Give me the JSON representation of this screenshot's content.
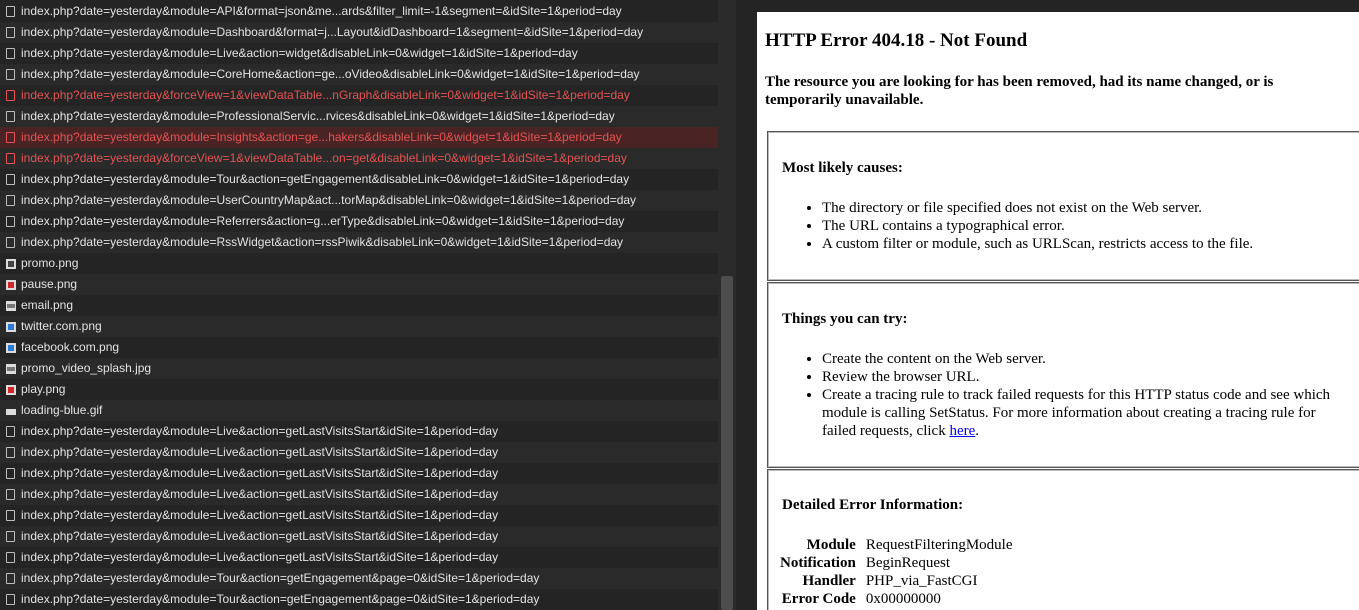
{
  "requests": [
    {
      "label": "index.php?date=yesterday&module=API&format=json&me...ards&filter_limit=-1&segment=&idSite=1&period=day",
      "icon": "doc-icon",
      "kind": "doc",
      "status": "ok"
    },
    {
      "label": "index.php?date=yesterday&module=Dashboard&format=j...Layout&idDashboard=1&segment=&idSite=1&period=day",
      "icon": "doc-icon",
      "kind": "doc",
      "status": "ok"
    },
    {
      "label": "index.php?date=yesterday&module=Live&action=widget&disableLink=0&widget=1&idSite=1&period=day",
      "icon": "doc-icon",
      "kind": "doc",
      "status": "ok"
    },
    {
      "label": "index.php?date=yesterday&module=CoreHome&action=ge...oVideo&disableLink=0&widget=1&idSite=1&period=day",
      "icon": "doc-icon",
      "kind": "doc",
      "status": "ok"
    },
    {
      "label": "index.php?date=yesterday&forceView=1&viewDataTable...nGraph&disableLink=0&widget=1&idSite=1&period=day",
      "icon": "doc-icon",
      "kind": "doc",
      "status": "error"
    },
    {
      "label": "index.php?date=yesterday&module=ProfessionalServic...rvices&disableLink=0&widget=1&idSite=1&period=day",
      "icon": "doc-icon",
      "kind": "doc",
      "status": "ok"
    },
    {
      "label": "index.php?date=yesterday&module=Insights&action=ge...hakers&disableLink=0&widget=1&idSite=1&period=day",
      "icon": "doc-icon",
      "kind": "doc",
      "status": "error-selected"
    },
    {
      "label": "index.php?date=yesterday&forceView=1&viewDataTable...on=get&disableLink=0&widget=1&idSite=1&period=day",
      "icon": "doc-icon",
      "kind": "doc",
      "status": "error"
    },
    {
      "label": "index.php?date=yesterday&module=Tour&action=getEngagement&disableLink=0&widget=1&idSite=1&period=day",
      "icon": "doc-icon",
      "kind": "doc",
      "status": "ok"
    },
    {
      "label": "index.php?date=yesterday&module=UserCountryMap&act...torMap&disableLink=0&widget=1&idSite=1&period=day",
      "icon": "doc-icon",
      "kind": "doc",
      "status": "ok"
    },
    {
      "label": "index.php?date=yesterday&module=Referrers&action=g...erType&disableLink=0&widget=1&idSite=1&period=day",
      "icon": "doc-icon",
      "kind": "doc",
      "status": "ok"
    },
    {
      "label": "index.php?date=yesterday&module=RssWidget&action=rssPiwik&disableLink=0&widget=1&idSite=1&period=day",
      "icon": "doc-icon",
      "kind": "doc",
      "status": "ok"
    },
    {
      "label": "promo.png",
      "icon": "image-icon",
      "kind": "img dark",
      "status": "ok"
    },
    {
      "label": "pause.png",
      "icon": "image-icon",
      "kind": "img red",
      "status": "ok"
    },
    {
      "label": "email.png",
      "icon": "image-icon",
      "kind": "img gray",
      "status": "ok"
    },
    {
      "label": "twitter.com.png",
      "icon": "image-icon",
      "kind": "img blue",
      "status": "ok"
    },
    {
      "label": "facebook.com.png",
      "icon": "image-icon",
      "kind": "img blue",
      "status": "ok"
    },
    {
      "label": "promo_video_splash.jpg",
      "icon": "image-icon",
      "kind": "img gray",
      "status": "ok"
    },
    {
      "label": "play.png",
      "icon": "image-icon",
      "kind": "img red",
      "status": "ok"
    },
    {
      "label": "loading-blue.gif",
      "icon": "image-icon",
      "kind": "img flat",
      "status": "ok"
    },
    {
      "label": "index.php?date=yesterday&module=Live&action=getLastVisitsStart&idSite=1&period=day",
      "icon": "doc-icon",
      "kind": "doc",
      "status": "ok"
    },
    {
      "label": "index.php?date=yesterday&module=Live&action=getLastVisitsStart&idSite=1&period=day",
      "icon": "doc-icon",
      "kind": "doc",
      "status": "ok"
    },
    {
      "label": "index.php?date=yesterday&module=Live&action=getLastVisitsStart&idSite=1&period=day",
      "icon": "doc-icon",
      "kind": "doc",
      "status": "ok"
    },
    {
      "label": "index.php?date=yesterday&module=Live&action=getLastVisitsStart&idSite=1&period=day",
      "icon": "doc-icon",
      "kind": "doc",
      "status": "ok"
    },
    {
      "label": "index.php?date=yesterday&module=Live&action=getLastVisitsStart&idSite=1&period=day",
      "icon": "doc-icon",
      "kind": "doc",
      "status": "ok"
    },
    {
      "label": "index.php?date=yesterday&module=Live&action=getLastVisitsStart&idSite=1&period=day",
      "icon": "doc-icon",
      "kind": "doc",
      "status": "ok"
    },
    {
      "label": "index.php?date=yesterday&module=Live&action=getLastVisitsStart&idSite=1&period=day",
      "icon": "doc-icon",
      "kind": "doc",
      "status": "ok"
    },
    {
      "label": "index.php?date=yesterday&module=Tour&action=getEngagement&page=0&idSite=1&period=day",
      "icon": "doc-icon",
      "kind": "doc",
      "status": "ok"
    },
    {
      "label": "index.php?date=yesterday&module=Tour&action=getEngagement&page=0&idSite=1&period=day",
      "icon": "doc-icon",
      "kind": "doc",
      "status": "ok"
    }
  ],
  "colors": {
    "error_text": "#e45353",
    "selected_row": "#4a2424",
    "panel_bg": "#242424",
    "link": "#0000ee"
  },
  "error_page": {
    "title": "HTTP Error 404.18 - Not Found",
    "subtitle": "The resource you are looking for has been removed, had its name changed, or is temporarily unavailable.",
    "causes": {
      "heading": "Most likely causes:",
      "items": [
        "The directory or file specified does not exist on the Web server.",
        "The URL contains a typographical error.",
        "A custom filter or module, such as URLScan, restricts access to the file."
      ]
    },
    "try": {
      "heading": "Things you can try:",
      "item1": "Create the content on the Web server.",
      "item2": "Review the browser URL.",
      "item3_text": "Create a tracing rule to track failed requests for this HTTP status code and see which module is calling SetStatus. For more information about creating a tracing rule for failed requests, click ",
      "item3_link": "here",
      "item3_end": "."
    },
    "details": {
      "heading": "Detailed Error Information:",
      "rows": [
        {
          "key": "Module",
          "value": "RequestFilteringModule"
        },
        {
          "key": "Notification",
          "value": "BeginRequest"
        },
        {
          "key": "Handler",
          "value": "PHP_via_FastCGI"
        },
        {
          "key": "Error Code",
          "value": "0x00000000"
        }
      ]
    }
  }
}
